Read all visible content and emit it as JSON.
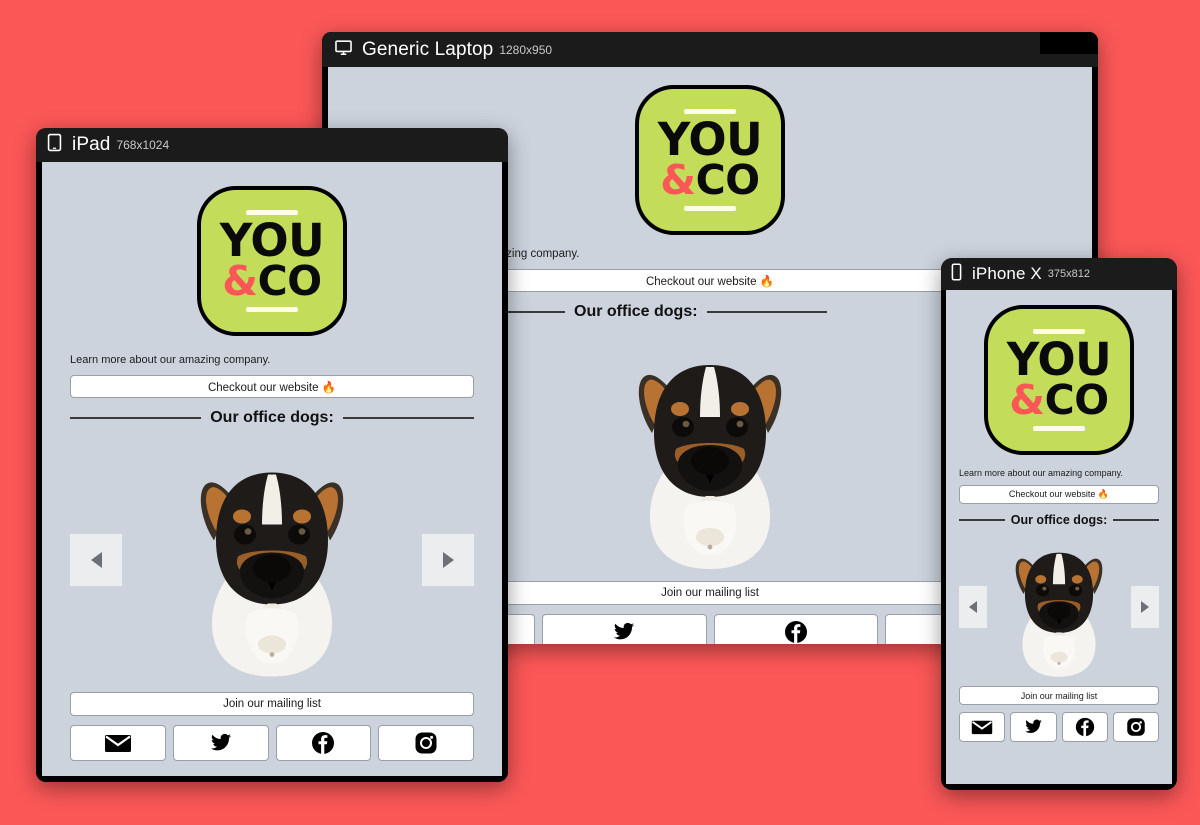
{
  "background_color": "#fb5757",
  "page": {
    "background_color": "#ccd3dd",
    "logo": {
      "bg_color": "#c3dc5a",
      "text_top": "YOU",
      "text_bottom_amp": "&",
      "text_bottom": "CO",
      "amp_color": "#fb5757",
      "rule_color": "#fdfde8"
    },
    "tagline": "Learn more about our amazing company.",
    "cta_button": "Checkout our website 🔥",
    "section_heading": "Our office dogs:",
    "carousel": {
      "prev_label": "◀",
      "next_label": "▶",
      "image_alt": "office dog"
    },
    "mailing_button": "Join our mailing list",
    "social": [
      {
        "name": "email",
        "label": "Email"
      },
      {
        "name": "twitter",
        "label": "Twitter"
      },
      {
        "name": "facebook",
        "label": "Facebook"
      },
      {
        "name": "instagram",
        "label": "Instagram"
      }
    ]
  },
  "devices": [
    {
      "id": "laptop",
      "icon": "monitor-icon",
      "title": "Generic Laptop",
      "dimensions": "1280x950"
    },
    {
      "id": "ipad",
      "icon": "tablet-icon",
      "title": "iPad",
      "dimensions": "768x1024"
    },
    {
      "id": "iphone",
      "icon": "phone-icon",
      "title": "iPhone X",
      "dimensions": "375x812"
    }
  ]
}
